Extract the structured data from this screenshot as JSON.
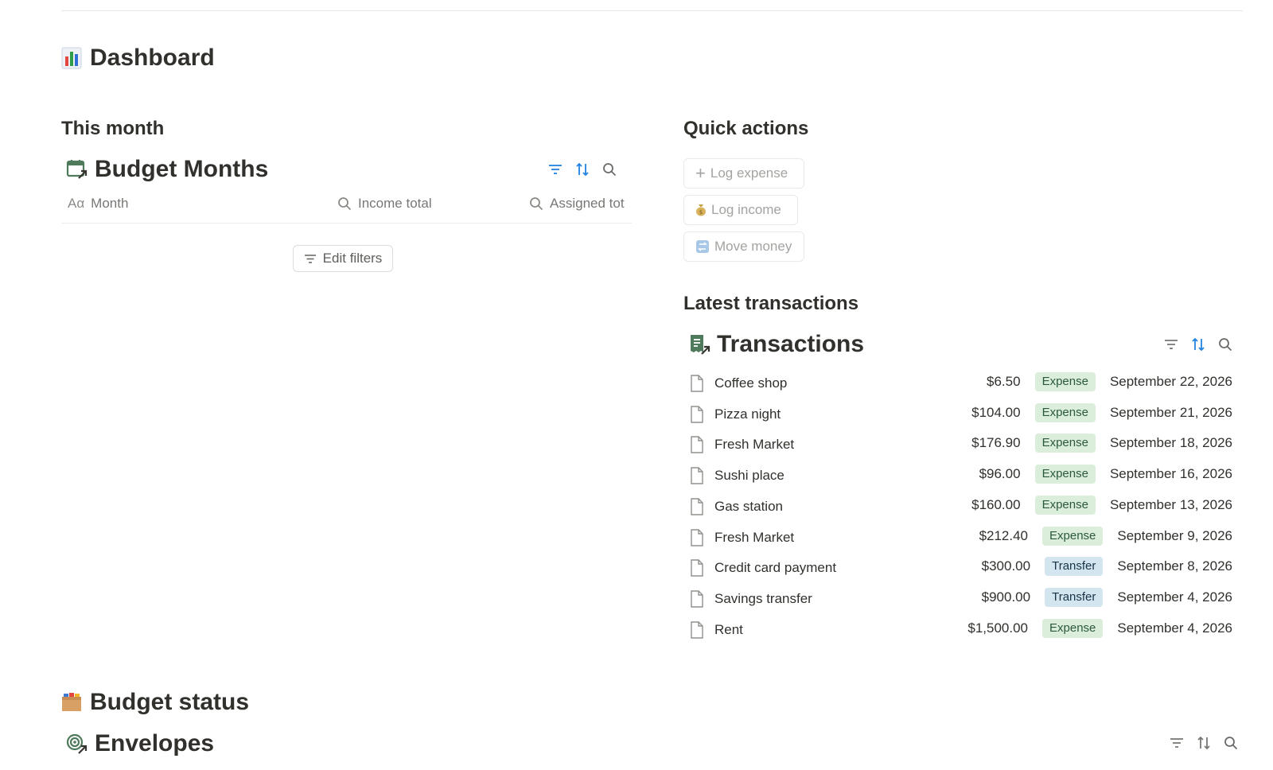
{
  "page": {
    "title": "Dashboard",
    "title_icon": "bar-chart-icon"
  },
  "this_month": {
    "heading": "This month",
    "database": {
      "title": "Budget Months",
      "icon": "calendar-arrow-icon",
      "columns": [
        {
          "label": "Month",
          "icon": "text-aa-icon"
        },
        {
          "label": "Income total",
          "icon": "search-icon"
        },
        {
          "label": "Assigned tot",
          "icon": "search-icon"
        }
      ],
      "edit_filters_label": "Edit filters"
    }
  },
  "quick_actions": {
    "heading": "Quick actions",
    "buttons": [
      {
        "label": "Log expense",
        "icon": "plus-icon"
      },
      {
        "label": "Log income",
        "icon": "money-bag-icon"
      },
      {
        "label": "Move money",
        "icon": "transfer-arrows-icon"
      }
    ]
  },
  "latest_transactions": {
    "heading": "Latest transactions",
    "database": {
      "title": "Transactions",
      "icon": "receipt-arrow-icon",
      "rows": [
        {
          "name": "Coffee shop",
          "amount": "$6.50",
          "type": "Expense",
          "date": "September 22, 2026"
        },
        {
          "name": "Pizza night",
          "amount": "$104.00",
          "type": "Expense",
          "date": "September 21, 2026"
        },
        {
          "name": "Fresh Market",
          "amount": "$176.90",
          "type": "Expense",
          "date": "September 18, 2026"
        },
        {
          "name": "Sushi place",
          "amount": "$96.00",
          "type": "Expense",
          "date": "September 16, 2026"
        },
        {
          "name": "Gas station",
          "amount": "$160.00",
          "type": "Expense",
          "date": "September 13, 2026"
        },
        {
          "name": "Fresh Market",
          "amount": "$212.40",
          "type": "Expense",
          "date": "September 9, 2026"
        },
        {
          "name": "Credit card payment",
          "amount": "$300.00",
          "type": "Transfer",
          "date": "September 8, 2026"
        },
        {
          "name": "Savings transfer",
          "amount": "$900.00",
          "type": "Transfer",
          "date": "September 4, 2026"
        },
        {
          "name": "Rent",
          "amount": "$1,500.00",
          "type": "Expense",
          "date": "September 4, 2026"
        }
      ]
    }
  },
  "budget_status": {
    "heading": "Budget status",
    "heading_icon": "folder-icon",
    "database": {
      "title": "Envelopes",
      "icon": "target-arrow-icon"
    }
  },
  "colors": {
    "accent": "#2383e2",
    "expense_bg": "#dbeddb",
    "expense_fg": "#2b593f",
    "transfer_bg": "#d3e5ef",
    "transfer_fg": "#183347"
  }
}
